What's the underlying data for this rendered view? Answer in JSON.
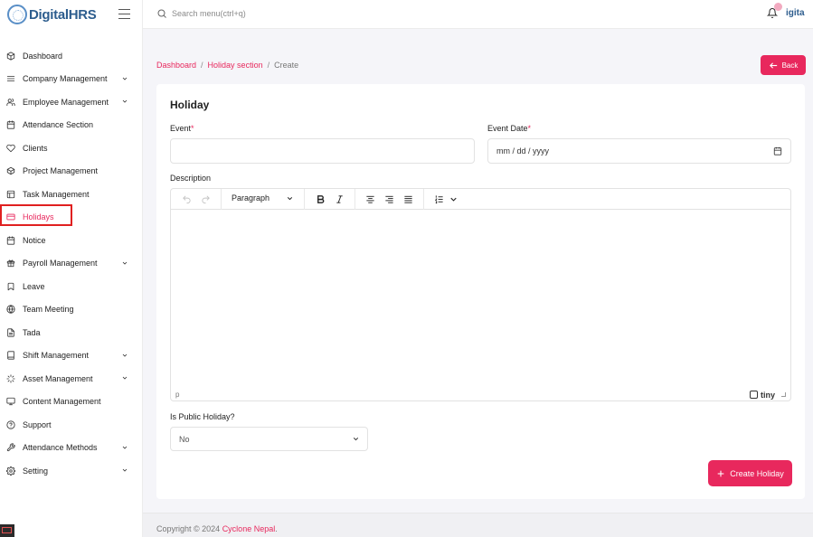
{
  "app": {
    "logo_text": "DigitalHRS",
    "user_short": "igita"
  },
  "search": {
    "placeholder": "Search menu(ctrl+q)"
  },
  "sidebar": {
    "items": [
      {
        "label": "Dashboard",
        "icon": "cube-icon",
        "expandable": false,
        "active": false
      },
      {
        "label": "Company Management",
        "icon": "list-icon",
        "expandable": true,
        "active": false
      },
      {
        "label": "Employee Management",
        "icon": "users-icon",
        "expandable": true,
        "active": false
      },
      {
        "label": "Attendance Section",
        "icon": "calendar-icon",
        "expandable": false,
        "active": false
      },
      {
        "label": "Clients",
        "icon": "heart-icon",
        "expandable": false,
        "active": false
      },
      {
        "label": "Project Management",
        "icon": "box-icon",
        "expandable": false,
        "active": false
      },
      {
        "label": "Task Management",
        "icon": "grid-icon",
        "expandable": false,
        "active": false
      },
      {
        "label": "Holidays",
        "icon": "card-icon",
        "expandable": false,
        "active": true
      },
      {
        "label": "Notice",
        "icon": "calendar-icon",
        "expandable": false,
        "active": false
      },
      {
        "label": "Payroll Management",
        "icon": "gift-icon",
        "expandable": true,
        "active": false
      },
      {
        "label": "Leave",
        "icon": "bookmark-icon",
        "expandable": false,
        "active": false
      },
      {
        "label": "Team Meeting",
        "icon": "globe-icon",
        "expandable": false,
        "active": false
      },
      {
        "label": "Tada",
        "icon": "file-icon",
        "expandable": false,
        "active": false
      },
      {
        "label": "Shift Management",
        "icon": "book-icon",
        "expandable": true,
        "active": false
      },
      {
        "label": "Asset Management",
        "icon": "loader-icon",
        "expandable": true,
        "active": false
      },
      {
        "label": "Content Management",
        "icon": "monitor-icon",
        "expandable": false,
        "active": false
      },
      {
        "label": "Support",
        "icon": "help-circle-icon",
        "expandable": false,
        "active": false
      },
      {
        "label": "Attendance Methods",
        "icon": "tool-icon",
        "expandable": true,
        "active": false
      },
      {
        "label": "Setting",
        "icon": "gear-icon",
        "expandable": true,
        "active": false
      }
    ]
  },
  "breadcrumb": {
    "items": [
      "Dashboard",
      "Holiday section"
    ],
    "separator": "/",
    "current": "Create"
  },
  "back_button": {
    "label": "Back"
  },
  "form": {
    "title": "Holiday",
    "event_label": "Event",
    "required_mark": "*",
    "event_value": "",
    "event_date_label": "Event Date",
    "event_date_placeholder": "mm / dd / yyyy",
    "description_label": "Description",
    "editor": {
      "block_format": "Paragraph",
      "status_path": "p",
      "brand": "tiny"
    },
    "public_holiday_label": "Is Public Holiday?",
    "public_holiday_value": "No",
    "submit_label": "Create Holiday"
  },
  "footer": {
    "copyright_prefix": "Copyright © 2024",
    "company": "Cyclone Nepal",
    "suffix": "."
  },
  "colors": {
    "accent": "#e8285d",
    "brand_blue": "#2d5d8e",
    "highlight": "#e02020"
  }
}
